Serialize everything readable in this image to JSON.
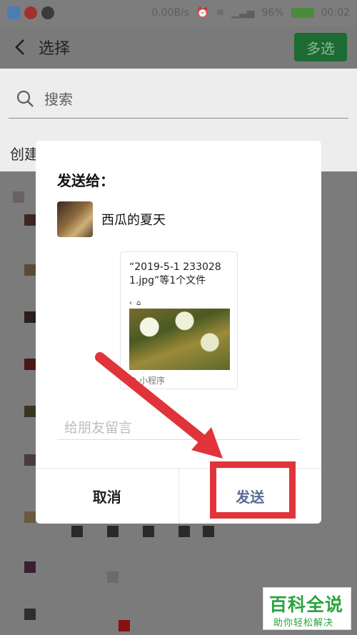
{
  "status_bar": {
    "net_speed": "0.00B/s",
    "battery": "96%",
    "time": "00:02"
  },
  "nav": {
    "title": "选择",
    "multi_select_label": "多选"
  },
  "search": {
    "placeholder": "搜索"
  },
  "section": {
    "create_label": "创建"
  },
  "dialog": {
    "heading": "发送给：",
    "recipient_name": "西瓜的夏天",
    "card": {
      "title": "“2019-5-1 233028\n1.jpg”等1个文件",
      "footer_label": "小程序"
    },
    "message_placeholder": "给朋友留言",
    "cancel_label": "取消",
    "send_label": "发送"
  },
  "watermark": {
    "big": "百科全说",
    "small": "助你轻松解决"
  },
  "colors": {
    "accent_green": "#1b6b33",
    "send_blue": "#576b95",
    "annotation_red": "#e0343a",
    "watermark_green": "#2aa43e"
  }
}
